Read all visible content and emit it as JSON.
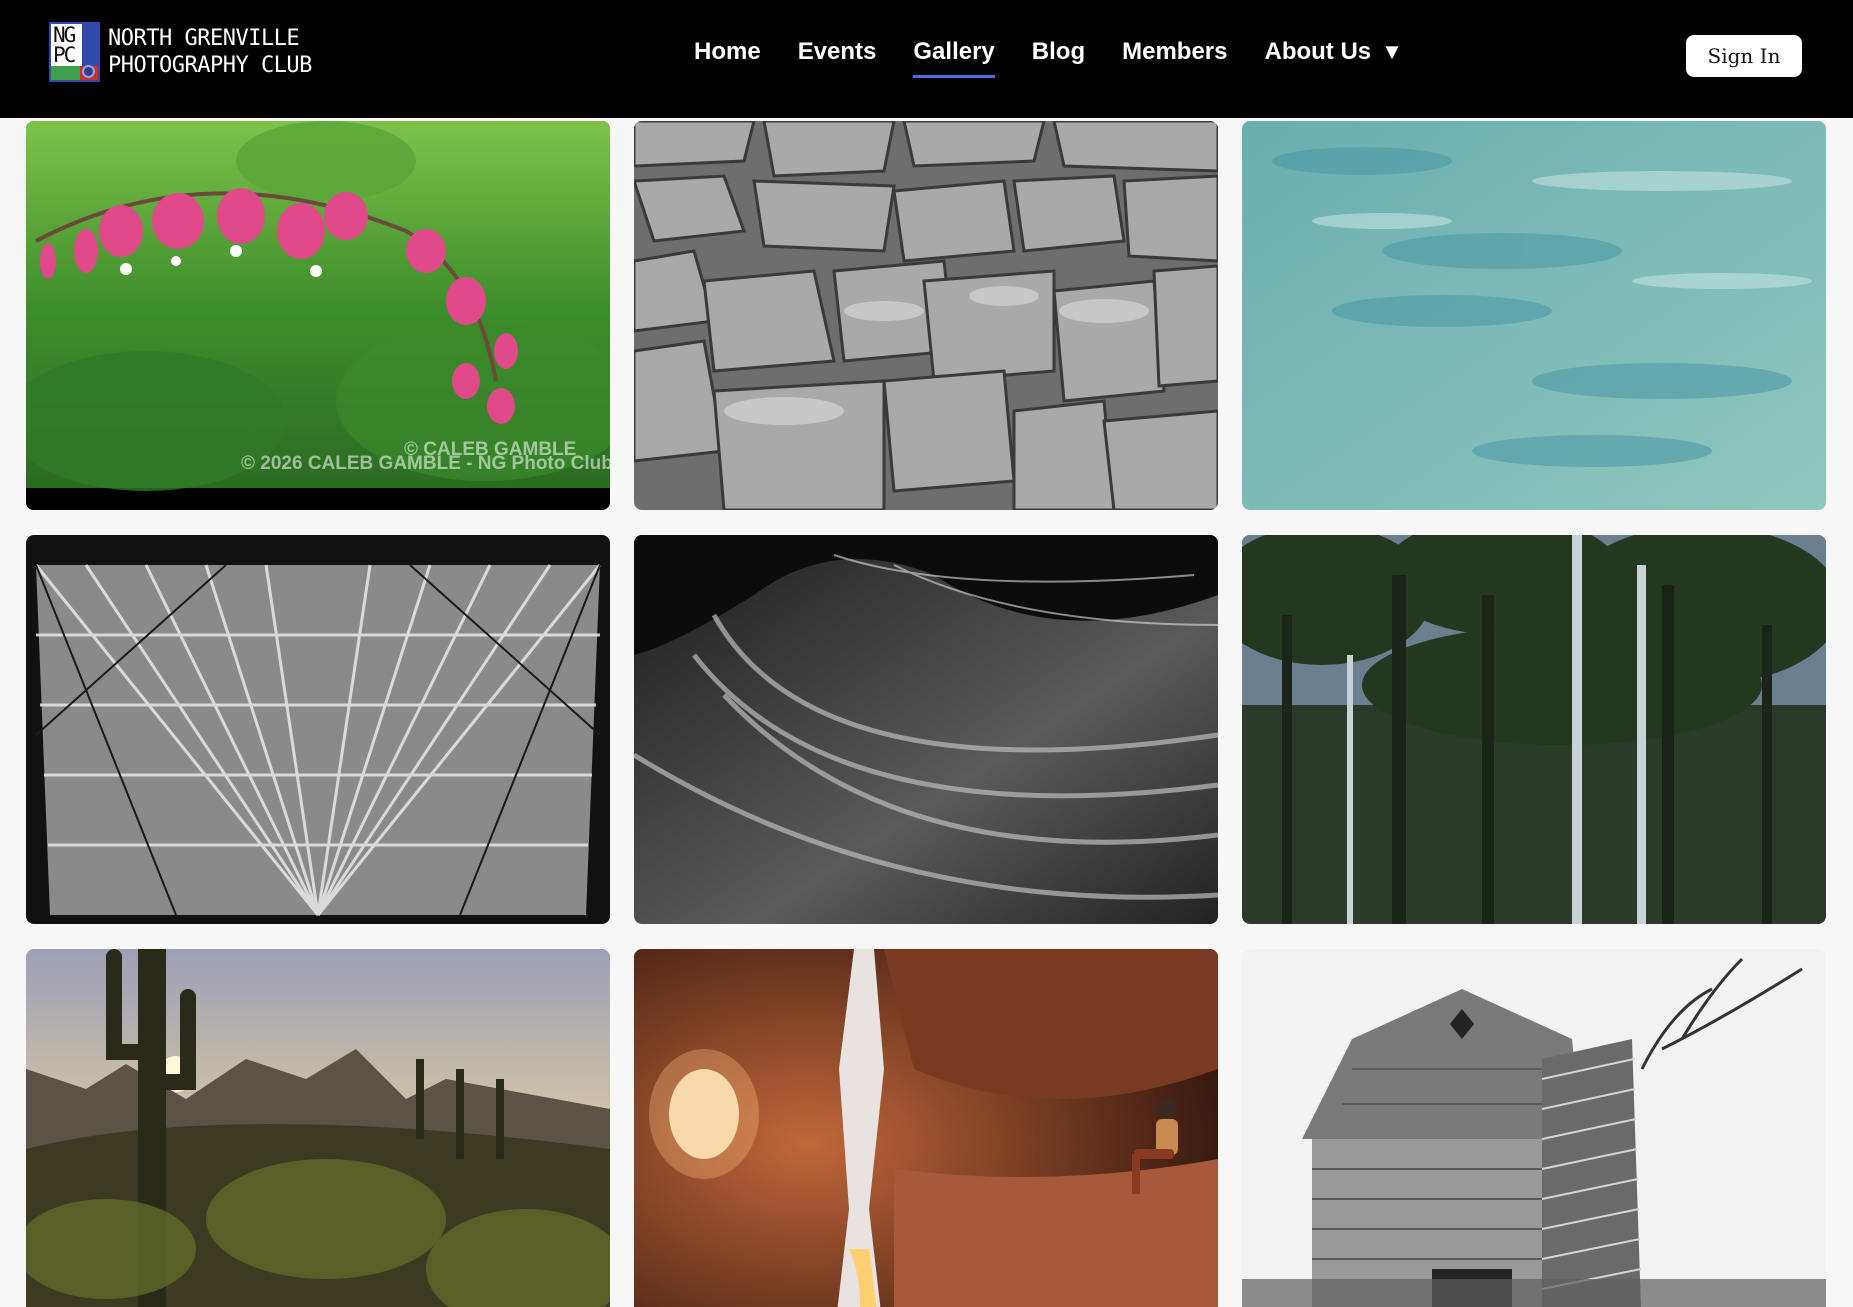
{
  "header": {
    "logo_line1": "NORTH GRENVILLE",
    "logo_line2": "PHOTOGRAPHY CLUB",
    "logo_mark_text": "NG PC",
    "nav": [
      {
        "label": "Home",
        "active": false
      },
      {
        "label": "Events",
        "active": false
      },
      {
        "label": "Gallery",
        "active": true
      },
      {
        "label": "Blog",
        "active": false
      },
      {
        "label": "Members",
        "active": false
      },
      {
        "label": "About Us",
        "active": false,
        "has_dropdown": true
      }
    ],
    "dropdown_caret": "▼",
    "signin_label": "Sign In",
    "accent_color": "#4c6fe0"
  },
  "gallery": {
    "photos": [
      {
        "subject": "pink bleeding heart flowers",
        "watermark": "© 2026 CALEB GAMBLE - NG Photo Club",
        "watermark2": "© CALEB GAMBLE"
      },
      {
        "subject": "hexagonal basalt columns, black and white"
      },
      {
        "subject": "turquoise rippling water"
      },
      {
        "subject": "glass pyramid ceiling, black and white"
      },
      {
        "subject": "slot canyon sandstone waves, black and white"
      },
      {
        "subject": "forest of tall trees"
      },
      {
        "subject": "saguaro cactus at sunset"
      },
      {
        "subject": "person sitting in red sandstone cave"
      },
      {
        "subject": "old barn and silo, black and white"
      }
    ]
  }
}
